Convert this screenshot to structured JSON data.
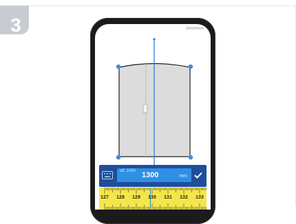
{
  "step": {
    "number": "3"
  },
  "measurement": {
    "alt_label": "alt: 1050",
    "value": "1300",
    "unit": "mm"
  },
  "ruler": {
    "labels": [
      "127",
      "128",
      "129",
      "130",
      "131",
      "132",
      "133"
    ]
  },
  "colors": {
    "accent_blue": "#2f8fe5",
    "bar_dark_blue": "#1f4e9a",
    "ruler_yellow": "#f4e64a",
    "door_gray": "#dcdcdc",
    "step_badge": "#c8ccd2"
  },
  "icons": {
    "keyboard": "keyboard-icon",
    "confirm": "checkmark-icon",
    "handles": "corner-handle-icon"
  }
}
